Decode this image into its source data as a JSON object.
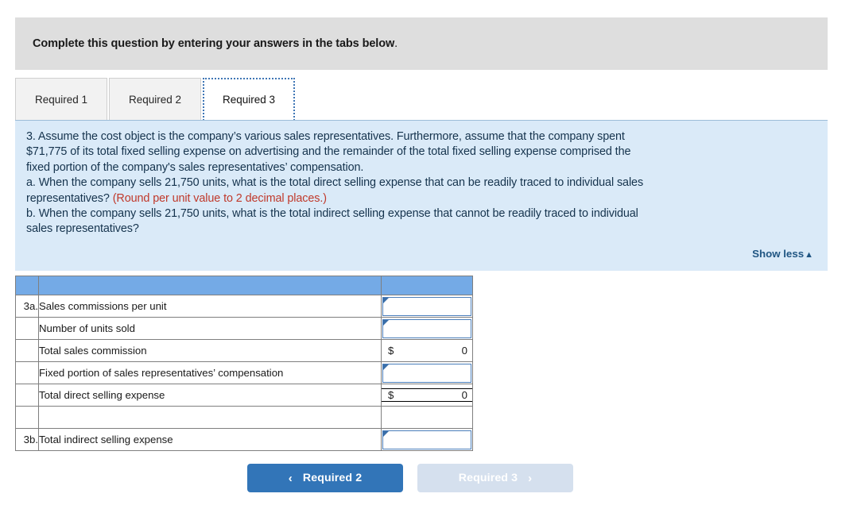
{
  "instruction": {
    "bold_part": "Complete this question by entering your answers in the tabs below",
    "tail": "."
  },
  "tabs": [
    {
      "label": "Required 1",
      "active": false
    },
    {
      "label": "Required 2",
      "active": false
    },
    {
      "label": "Required 3",
      "active": true
    }
  ],
  "question": {
    "lines": [
      "3. Assume the cost object is the company’s various sales representatives. Furthermore, assume that the company spent",
      "$71,775 of its total fixed selling expense on advertising and the remainder of the total fixed selling expense comprised the",
      "fixed portion of the company's sales representatives’ compensation.",
      "a. When the company sells 21,750 units, what is the total direct selling expense that can be readily traced to individual sales",
      "b. When the company sells 21,750 units, what is the total indirect selling expense that cannot be readily traced to individual",
      "sales representatives?"
    ],
    "line4_prefix": "representatives? ",
    "line4_red": "(Round per unit value to 2 decimal places.)",
    "show_less_label": "Show less",
    "show_less_caret": "▲"
  },
  "table": {
    "rows": [
      {
        "idx": "3a.",
        "label": "Sales commissions per unit",
        "kind": "entry",
        "currency": "",
        "value": ""
      },
      {
        "idx": "",
        "label": "Number of units sold",
        "kind": "entry",
        "currency": "",
        "value": ""
      },
      {
        "idx": "",
        "label": "Total sales commission",
        "kind": "money",
        "currency": "$",
        "value": "0"
      },
      {
        "idx": "",
        "label": "Fixed portion of sales representatives’ compensation",
        "kind": "entry",
        "currency": "",
        "value": ""
      },
      {
        "idx": "",
        "label": "Total direct selling expense",
        "kind": "total",
        "currency": "$",
        "value": "0"
      },
      {
        "idx": "",
        "label": "",
        "kind": "blank",
        "currency": "",
        "value": ""
      },
      {
        "idx": "3b.",
        "label": "Total indirect selling expense",
        "kind": "entry",
        "currency": "",
        "value": ""
      }
    ]
  },
  "nav": {
    "prev_label": "Required 2",
    "prev_chevron": "‹",
    "next_label": "Required 3",
    "next_chevron": "›"
  },
  "colors": {
    "instruction_bg": "#dedede",
    "panel_bg": "#daeaf8",
    "table_header": "#74aae6",
    "accent_blue": "#3275b8",
    "disabled_blue": "#d5e0ee",
    "red": "#c0392b",
    "link_blue": "#1f5582"
  }
}
